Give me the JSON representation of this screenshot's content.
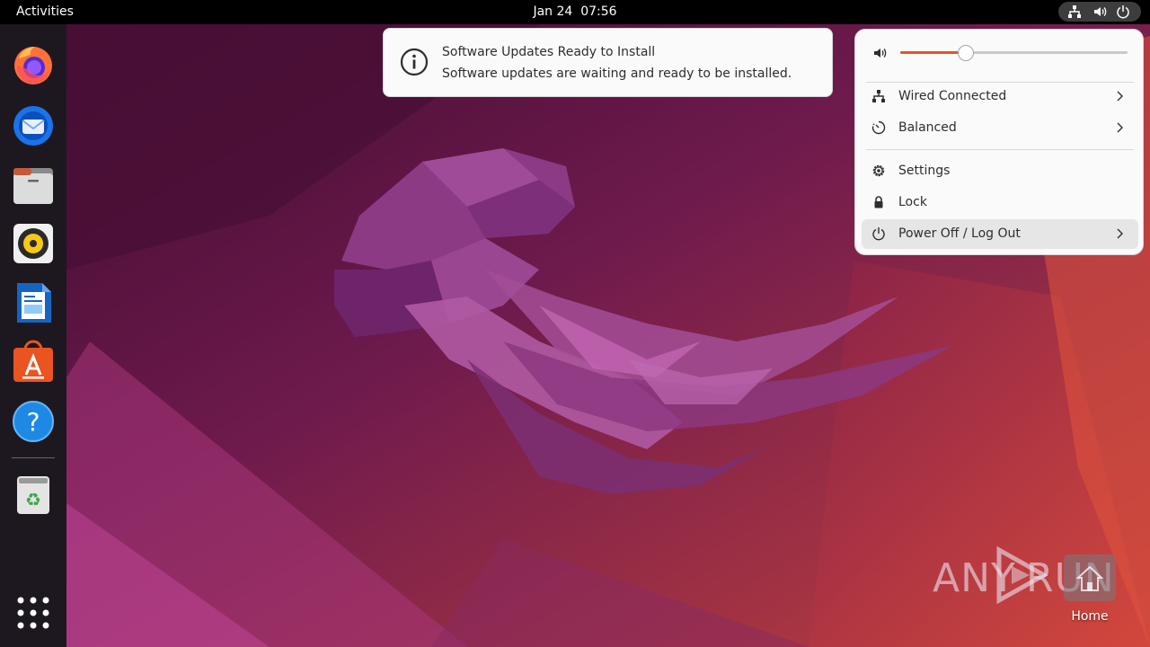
{
  "topbar": {
    "activities_label": "Activities",
    "date": "Jan 24",
    "time": "07:56",
    "tray_icons": [
      "network-icon",
      "volume-icon",
      "power-icon"
    ]
  },
  "dock": {
    "apps": [
      {
        "name": "Firefox",
        "icon": "firefox-icon"
      },
      {
        "name": "Thunderbird",
        "icon": "thunderbird-icon"
      },
      {
        "name": "Files",
        "icon": "files-icon"
      },
      {
        "name": "Rhythmbox",
        "icon": "rhythmbox-icon"
      },
      {
        "name": "LibreOffice Writer",
        "icon": "writer-icon"
      },
      {
        "name": "Ubuntu Software",
        "icon": "software-icon"
      },
      {
        "name": "Help",
        "icon": "help-icon"
      }
    ],
    "trash": {
      "name": "Trash",
      "icon": "trash-icon"
    },
    "show_apps_icon": "apps-grid-icon"
  },
  "notification": {
    "icon": "info-icon",
    "title": "Software Updates Ready to Install",
    "body": "Software updates are waiting and ready to be installed."
  },
  "system_menu": {
    "volume": {
      "icon": "volume-icon",
      "level": 0.29
    },
    "items": [
      {
        "label": "Wired Connected",
        "icon": "network-wired-icon",
        "has_submenu": true
      },
      {
        "label": "Balanced",
        "icon": "power-profile-icon",
        "has_submenu": true
      },
      {
        "label": "Settings",
        "icon": "settings-icon",
        "has_submenu": false
      },
      {
        "label": "Lock",
        "icon": "lock-icon",
        "has_submenu": false
      },
      {
        "label": "Power Off / Log Out",
        "icon": "power-icon",
        "has_submenu": true,
        "highlighted": true
      }
    ]
  },
  "desktop": {
    "home_label": "Home"
  },
  "watermark": {
    "left_text": "ANY",
    "right_text": "RUN"
  },
  "colors": {
    "accent": "#e95420",
    "topbar_bg": "#000000",
    "dock_bg": "#1d1820",
    "menu_bg": "#fafafa"
  }
}
